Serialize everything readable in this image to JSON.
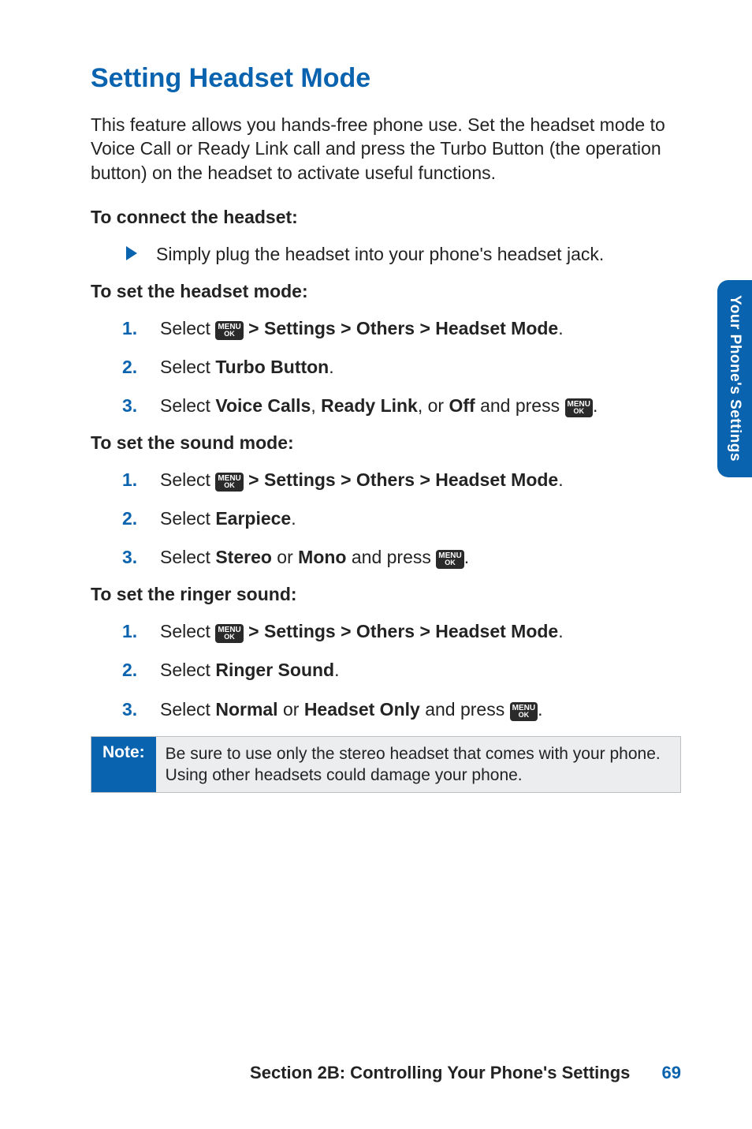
{
  "title": "Setting Headset Mode",
  "intro": "This feature allows you hands-free phone use. Set the headset mode to Voice Call or Ready Link call and press the Turbo Button (the operation button) on the headset to activate useful functions.",
  "icon": {
    "line1": "MENU",
    "line2": "OK"
  },
  "proc1": {
    "heading": "To connect the headset:",
    "bullet": "Simply plug the headset into your phone's headset jack."
  },
  "proc2": {
    "heading": "To set the headset mode:",
    "s1": {
      "pre": "Select ",
      "post": " > Settings > Others > Headset Mode",
      "end": "."
    },
    "s2": {
      "pre": "Select ",
      "b1": "Turbo Button",
      "end": "."
    },
    "s3": {
      "pre": "Select ",
      "b1": "Voice Calls",
      "sep1": ", ",
      "b2": "Ready Link",
      "sep2": ", or ",
      "b3": "Off",
      "mid": " and press ",
      "end": "."
    }
  },
  "proc3": {
    "heading": "To set the sound mode:",
    "s1": {
      "pre": "Select ",
      "post": " > Settings > Others > Headset Mode",
      "end": "."
    },
    "s2": {
      "pre": "Select ",
      "b1": "Earpiece",
      "end": "."
    },
    "s3": {
      "pre": "Select ",
      "b1": "Stereo",
      "sep1": " or ",
      "b2": "Mono",
      "mid": " and press ",
      "end": "."
    }
  },
  "proc4": {
    "heading": "To set the ringer sound:",
    "s1": {
      "pre": "Select ",
      "post": " > Settings > Others > Headset Mode",
      "end": "."
    },
    "s2": {
      "pre": "Select ",
      "b1": "Ringer Sound",
      "end": "."
    },
    "s3": {
      "pre": "Select ",
      "b1": "Normal",
      "sep1": " or ",
      "b2": "Headset Only",
      "mid": " and press ",
      "end": "."
    }
  },
  "note": {
    "label": "Note:",
    "text": "Be sure to use only the stereo headset that comes with your phone. Using other headsets could damage your phone."
  },
  "sideTab": "Your Phone's Settings",
  "footer": {
    "text": "Section 2B: Controlling Your Phone's Settings",
    "page": "69"
  }
}
